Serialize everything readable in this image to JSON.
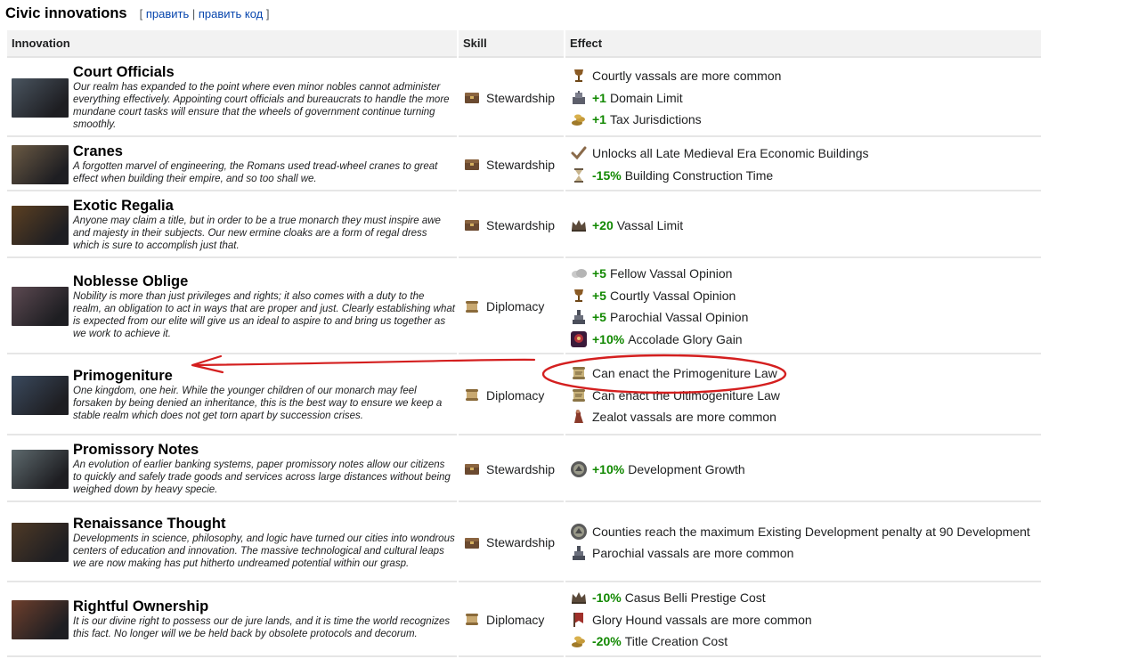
{
  "section": {
    "title": "Civic innovations",
    "edit": "править",
    "edit_code": "править код"
  },
  "columns": {
    "innovation": "Innovation",
    "skill": "Skill",
    "effect": "Effect"
  },
  "rows": [
    {
      "name": "Court Officials",
      "desc": "Our realm has expanded to the point where even minor nobles cannot administer everything effectively. Appointing court officials and bureaucrats to handle the more mundane court tasks will ensure that the wheels of government continue turning smoothly.",
      "skill": "Stewardship",
      "skill_icon": "stewardship-icon",
      "thumb_color": "#4a5560",
      "effects": [
        {
          "icon": "chalice-icon",
          "value": "",
          "text": "Courtly vassals are more common"
        },
        {
          "icon": "domain-icon",
          "value": "+1",
          "text": "Domain Limit"
        },
        {
          "icon": "gold-icon",
          "value": "+1",
          "text": "Tax Jurisdictions"
        }
      ]
    },
    {
      "name": "Cranes",
      "desc": "A forgotten marvel of engineering, the Romans used tread-wheel cranes to great effect when building their empire, and so too shall we.",
      "skill": "Stewardship",
      "skill_icon": "stewardship-icon",
      "thumb_color": "#6b5a44",
      "effects": [
        {
          "icon": "checkmark-icon",
          "value": "",
          "text": "Unlocks all Late Medieval Era Economic Buildings"
        },
        {
          "icon": "hourglass-icon",
          "value": "-15%",
          "text": "Building Construction Time"
        }
      ]
    },
    {
      "name": "Exotic Regalia",
      "desc": "Anyone may claim a title, but in order to be a true monarch they must inspire awe and majesty in their subjects. Our new ermine cloaks are a form of regal dress which is sure to accomplish just that.",
      "skill": "Stewardship",
      "skill_icon": "stewardship-icon",
      "thumb_color": "#5c4022",
      "effects": [
        {
          "icon": "crown-icon",
          "value": "+20",
          "text": "Vassal Limit"
        }
      ]
    },
    {
      "name": "Noblesse Oblige",
      "desc": "Nobility is more than just privileges and rights; it also comes with a duty to the realm, an obligation to act in ways that are proper and just. Clearly establishing what is expected from our elite will give us an ideal to aspire to and bring us together as we work to achieve it.",
      "skill": "Diplomacy",
      "skill_icon": "diplomacy-icon",
      "thumb_color": "#5d4a52",
      "effects": [
        {
          "icon": "cloud-icon",
          "value": "+5",
          "text": "Fellow Vassal Opinion"
        },
        {
          "icon": "chalice-icon",
          "value": "+5",
          "text": "Courtly Vassal Opinion"
        },
        {
          "icon": "parochial-icon",
          "value": "+5",
          "text": "Parochial Vassal Opinion"
        },
        {
          "icon": "glory-icon",
          "value": "+10%",
          "text": "Accolade Glory Gain"
        }
      ]
    },
    {
      "name": "Primogeniture",
      "desc": "One kingdom, one heir. While the younger children of our monarch may feel forsaken by being denied an inheritance, this is the best way to ensure we keep a stable realm which does not get torn apart by succession crises.",
      "skill": "Diplomacy",
      "skill_icon": "diplomacy-icon",
      "thumb_color": "#3b4a5e",
      "effects": [
        {
          "icon": "scroll-icon",
          "value": "",
          "text": "Can enact the Primogeniture Law"
        },
        {
          "icon": "scroll-icon",
          "value": "",
          "text": "Can enact the Ultimogeniture Law"
        },
        {
          "icon": "zealot-icon",
          "value": "",
          "text": "Zealot vassals are more common"
        }
      ]
    },
    {
      "name": "Promissory Notes",
      "desc": "An evolution of earlier banking systems, paper promissory notes allow our citizens to quickly and safely trade goods and services across large distances without being weighed down by heavy specie.",
      "skill": "Stewardship",
      "skill_icon": "stewardship-icon",
      "thumb_color": "#5e6a6e",
      "effects": [
        {
          "icon": "development-icon",
          "value": "+10%",
          "text": "Development Growth"
        }
      ]
    },
    {
      "name": "Renaissance Thought",
      "desc": "Developments in science, philosophy, and logic have turned our cities into wondrous centers of education and innovation. The massive technological and cultural leaps we are now making has put hitherto undreamed potential within our grasp.",
      "skill": "Stewardship",
      "skill_icon": "stewardship-icon",
      "thumb_color": "#4f3a26",
      "effects": [
        {
          "icon": "development-icon",
          "value": "",
          "text": "Counties reach the maximum Existing Development penalty at 90 Development"
        },
        {
          "icon": "parochial-icon",
          "value": "",
          "text": "Parochial vassals are more common"
        }
      ]
    },
    {
      "name": "Rightful Ownership",
      "desc": "It is our divine right to possess our de jure lands, and it is time the world recognizes this fact. No longer will we be held back by obsolete protocols and decorum.",
      "skill": "Diplomacy",
      "skill_icon": "diplomacy-icon",
      "thumb_color": "#6e3f2c",
      "effects": [
        {
          "icon": "crown-icon",
          "value": "-10%",
          "text": "Casus Belli Prestige Cost"
        },
        {
          "icon": "banner-icon",
          "value": "",
          "text": "Glory Hound vassals are more common"
        },
        {
          "icon": "gold-icon",
          "value": "-20%",
          "text": "Title Creation Cost"
        }
      ]
    }
  ],
  "colors": {
    "positive": "#118800",
    "link": "#0645ad",
    "annotation": "#d41f1f",
    "header_bg": "#f2f2f2"
  }
}
